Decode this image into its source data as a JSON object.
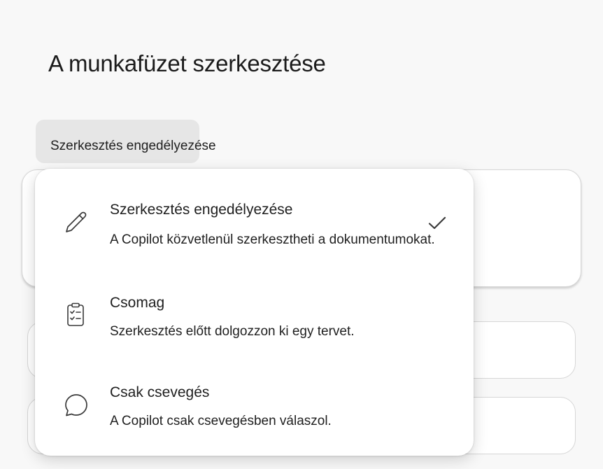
{
  "page": {
    "title": "A munkafüzet szerkesztése"
  },
  "mode_selector": {
    "selected_label": "Szerkesztés engedélyezése"
  },
  "dropdown": {
    "options": [
      {
        "title": "Szerkesztés engedélyezése",
        "description": "A Copilot közvetlenül szerkesztheti a dokumentumokat.",
        "icon": "pencil-icon",
        "selected": true
      },
      {
        "title": "Csomag",
        "description": "Szerkesztés előtt dolgozzon ki egy tervet.",
        "icon": "clipboard-checklist-icon",
        "selected": false
      },
      {
        "title": "Csak csevegés",
        "description": "A Copilot csak csevegésben válaszol.",
        "icon": "chat-bubble-icon",
        "selected": false
      }
    ],
    "selected_indicator_icon": "checkmark-icon"
  },
  "colors": {
    "page_background": "#f8f8f8",
    "chip_background": "#e6e6e6",
    "card_background": "#ffffff",
    "text": "#1f1f1f"
  }
}
